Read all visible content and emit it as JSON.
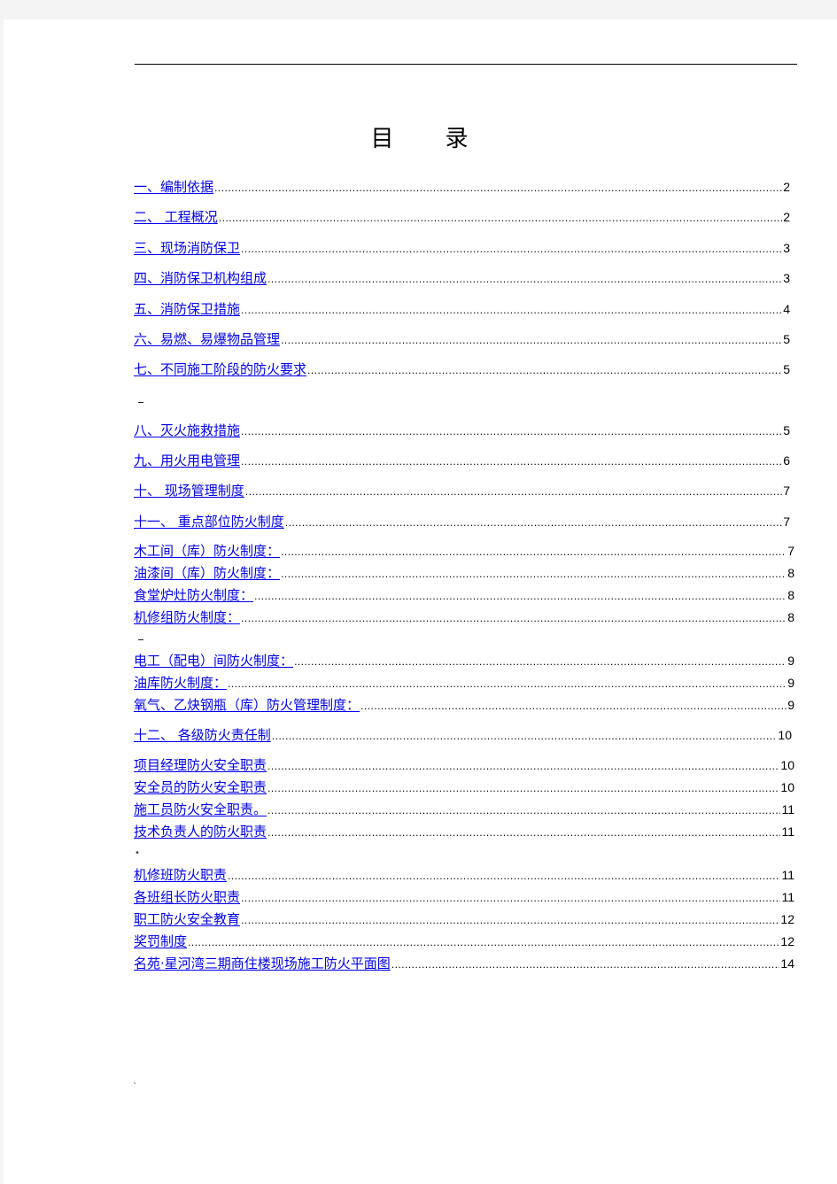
{
  "document": {
    "title_chars": [
      "目",
      "录"
    ],
    "footer_mark": "`"
  },
  "toc": [
    {
      "label": "一、编制依据",
      "page": "2"
    },
    {
      "label": "二、 工程概况",
      "page": "2"
    },
    {
      "label": "三、现场消防保卫",
      "page": "3"
    },
    {
      "label": "四、消防保卫机构组成",
      "page": "3"
    },
    {
      "label": "五、消防保卫措施",
      "page": "4"
    },
    {
      "label": "六、易燃、易爆物品管理",
      "page": "5"
    },
    {
      "label": "七、不同施工阶段的防火要求",
      "page": "5"
    },
    {
      "label": "八、灭火施救措施",
      "page": "5"
    },
    {
      "label": "九、用火用电管理",
      "page": "6"
    },
    {
      "label": "十、 现场管理制度",
      "page": "7"
    },
    {
      "label": "十一、 重点部位防火制度",
      "page": "7"
    },
    {
      "label": "木工间（库）防火制度：",
      "page": "7"
    },
    {
      "label": "油漆间（库）防火制度：",
      "page": "8"
    },
    {
      "label": "食堂炉灶防火制度：",
      "page": "8"
    },
    {
      "label": "机修组防火制度：",
      "page": "8"
    },
    {
      "label": "电工（配电）间防火制度：",
      "page": "9"
    },
    {
      "label": "油库防火制度：",
      "page": "9"
    },
    {
      "label": "氧气、乙炔钢瓶（库）防火管理制度：",
      "page": "9"
    },
    {
      "label": "十二、 各级防火责任制",
      "page": "10"
    },
    {
      "label": "项目经理防火安全职责",
      "page": "10"
    },
    {
      "label": "安全员的防火安全职责",
      "page": "10"
    },
    {
      "label": "施工员防火安全职责。",
      "page": "11"
    },
    {
      "label": "技术负责人的防火职责",
      "page": "11"
    },
    {
      "label": "机修班防火职责",
      "page": "11"
    },
    {
      "label": "各班组长防火职责",
      "page": "11"
    },
    {
      "label": "职工防火安全教育",
      "page": "12"
    },
    {
      "label": "奖罚制度",
      "page": "12"
    },
    {
      "label": "名苑·星河湾三期商住楼现场施工防火平面图",
      "page": "14"
    }
  ]
}
